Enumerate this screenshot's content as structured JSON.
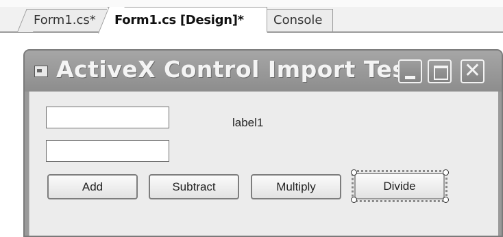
{
  "tabs": [
    {
      "label": "Form1.cs*"
    },
    {
      "label": "Form1.cs [Design]*"
    },
    {
      "label": "Console"
    }
  ],
  "form": {
    "title": "ActiveX Control Import Test",
    "caption_buttons": {
      "minimize_icon": "minimize-icon",
      "maximize_icon": "maximize-icon",
      "close_glyph": "✕"
    },
    "textbox1": {
      "value": ""
    },
    "textbox2": {
      "value": ""
    },
    "label1": "label1",
    "buttons": {
      "add": "Add",
      "subtract": "Subtract",
      "multiply": "Multiply",
      "divide": "Divide"
    },
    "selected_control": "Divide"
  }
}
